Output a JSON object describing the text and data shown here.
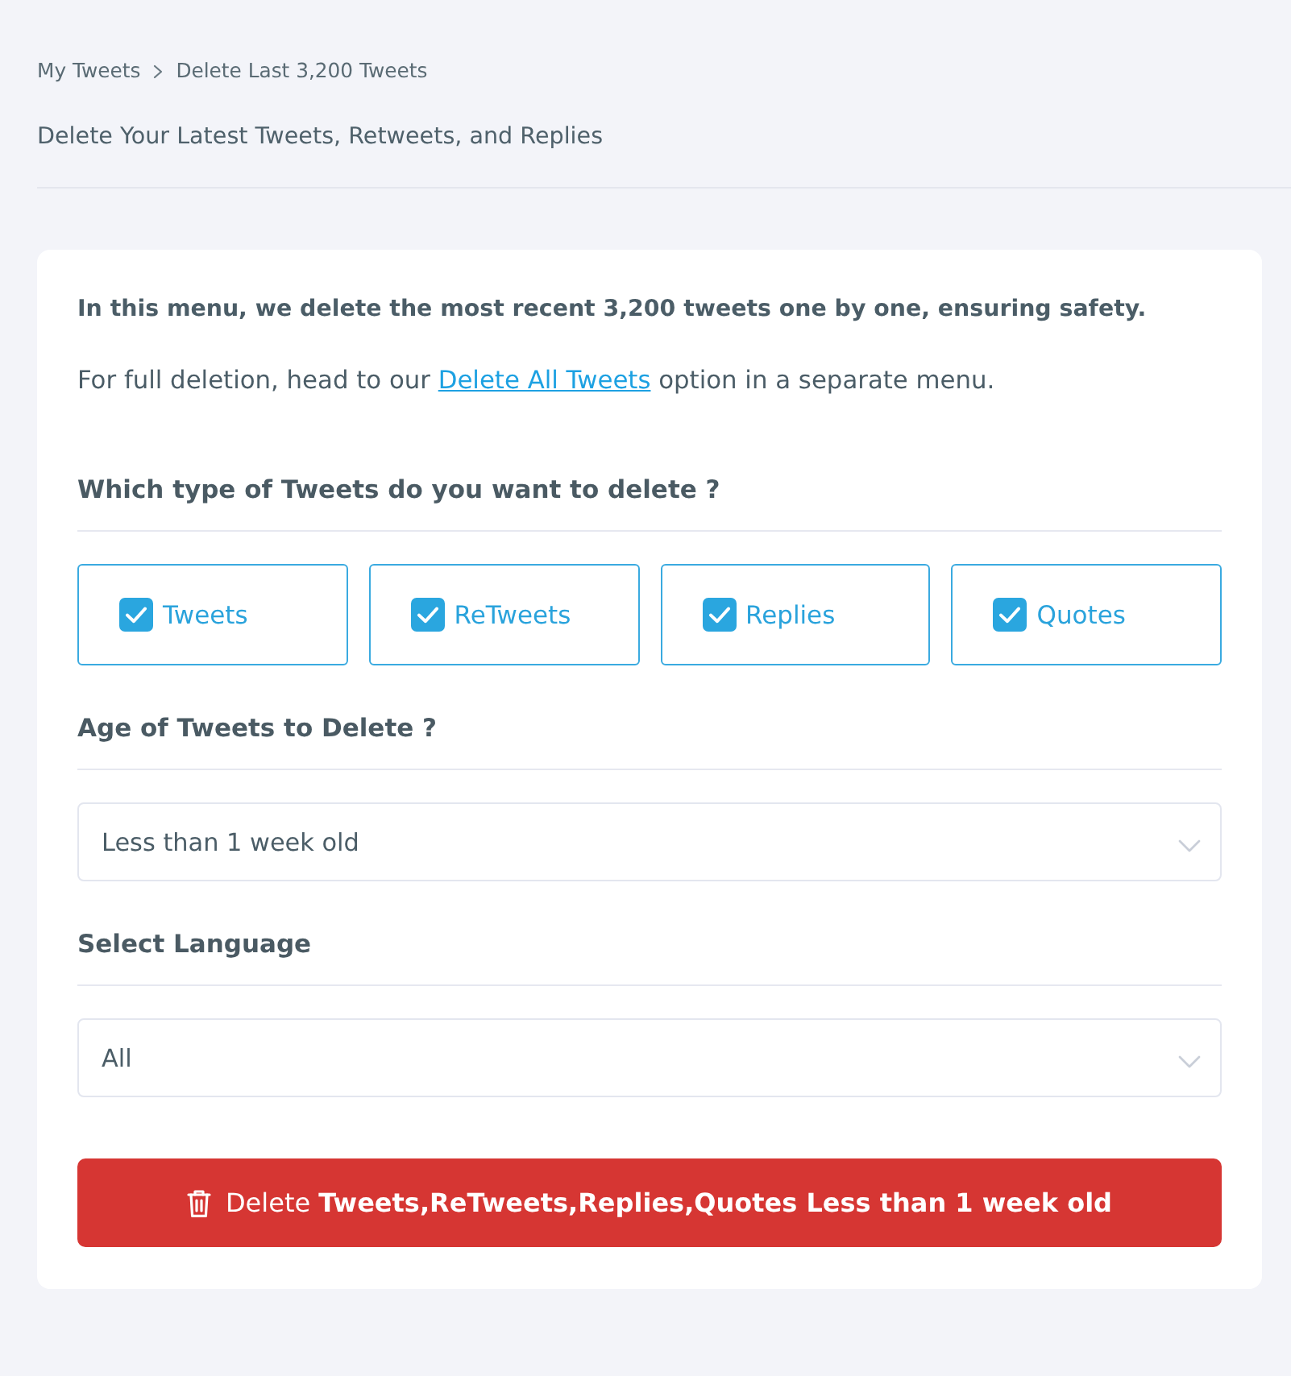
{
  "breadcrumb": {
    "items": [
      {
        "label": "My Tweets"
      },
      {
        "label": "Delete Last 3,200 Tweets"
      }
    ]
  },
  "page_title": "Delete Your Latest Tweets, Retweets, and Replies",
  "card": {
    "intro": "In this menu, we delete the most recent 3,200 tweets one by one, ensuring safety.",
    "note": {
      "before": "For full deletion, head to our ",
      "link": "Delete All Tweets",
      "after": " option in a separate menu."
    },
    "type_section": {
      "heading": "Which type of Tweets do you want to delete ?",
      "options": [
        {
          "label": "Tweets",
          "checked": true
        },
        {
          "label": "ReTweets",
          "checked": true
        },
        {
          "label": "Replies",
          "checked": true
        },
        {
          "label": "Quotes",
          "checked": true
        }
      ]
    },
    "age_section": {
      "heading": "Age of Tweets to Delete ?",
      "select": {
        "value": "Less than 1 week old"
      }
    },
    "language_section": {
      "heading": "Select Language",
      "select": {
        "value": "All"
      }
    },
    "delete_button": {
      "label": "Delete **Tweets,ReTweets,Replies,Quotes Less than 1 week old**"
    }
  }
}
